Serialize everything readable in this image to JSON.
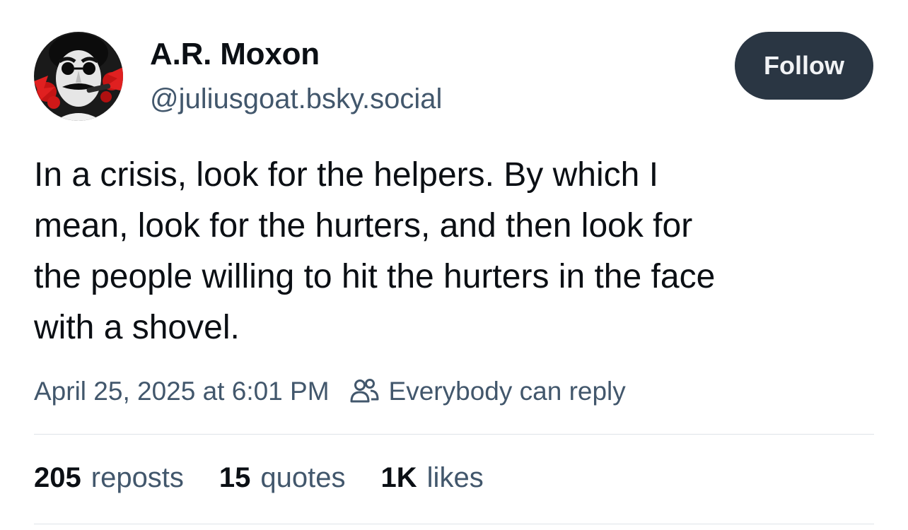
{
  "author": {
    "display_name": "A.R. Moxon",
    "handle": "@juliusgoat.bsky.social"
  },
  "follow_button": {
    "label": "Follow"
  },
  "post": {
    "text": "In a crisis, look for the helpers. By which I\nmean, look for the hurters, and then look for\nthe people willing to hit the hurters in the face\nwith a shovel.",
    "timestamp": "April 25, 2025 at 6:01 PM",
    "reply_setting": "Everybody can reply",
    "reply_setting_icon": "people-icon"
  },
  "stats": {
    "reposts": {
      "count": "205",
      "label": "reposts"
    },
    "quotes": {
      "count": "15",
      "label": "quotes"
    },
    "likes": {
      "count": "1K",
      "label": "likes"
    }
  },
  "colors": {
    "text_primary": "#0b0f14",
    "text_secondary": "#42576c",
    "follow_bg": "#2a3643",
    "divider": "#dfe3e8"
  }
}
